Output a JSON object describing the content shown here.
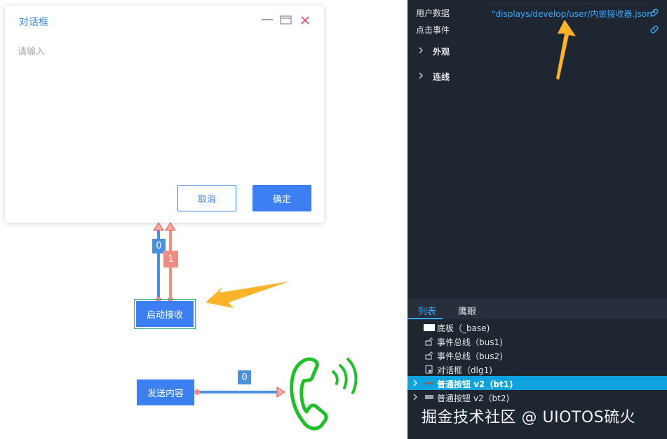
{
  "dialog": {
    "title": "对话框",
    "placeholder": "请输入",
    "cancel_label": "取消",
    "ok_label": "确定"
  },
  "canvas": {
    "start_button_label": "启动接收",
    "send_button_label": "发送内容",
    "tag_zero_top": "0",
    "tag_one": "1",
    "tag_zero_bottom": "0"
  },
  "properties": {
    "user_data_label": "用户数据",
    "user_data_value": "\"displays/develop/user/内嵌接收器.json\"",
    "click_event_label": "点击事件",
    "sections": [
      "外观",
      "连线"
    ]
  },
  "tabs": [
    "列表",
    "鹰眼"
  ],
  "tree": [
    {
      "label": "底板（_base)",
      "icon": "panel-icon"
    },
    {
      "label": "事件总线（bus1)",
      "icon": "bus-icon"
    },
    {
      "label": "事件总线（bus2)",
      "icon": "bus-icon"
    },
    {
      "label": "对话框（dlg1)",
      "icon": "dialog-icon"
    },
    {
      "label": "普通按钮 v2（bt1)",
      "icon": "button-icon",
      "selected": true
    },
    {
      "label": "普通按钮 v2（bt2)",
      "icon": "button-icon"
    }
  ],
  "watermark": "掘金技术社区 @ UIOTOS硫火",
  "colors": {
    "accent_blue": "#3c7ff3",
    "link_blue": "#33aaff",
    "panel_bg": "#1e2631",
    "selected_row": "#0ea3df",
    "arrow_orange": "#fbb32a",
    "phone_green": "#1fbf2a",
    "wire_blue": "#4a90e2",
    "wire_red": "#f28b82"
  }
}
